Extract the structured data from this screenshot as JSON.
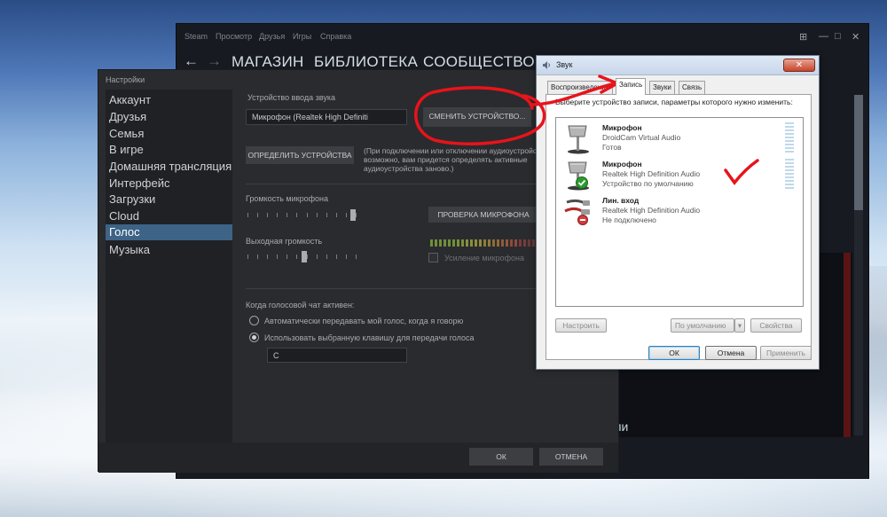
{
  "steam": {
    "menu": [
      "Steam",
      "Просмотр",
      "Друзья",
      "Игры",
      "Справка"
    ],
    "nav": {
      "back": "←",
      "forward": "→",
      "store": "МАГАЗИН",
      "library": "БИБЛИОТЕКА",
      "community": "СООБЩЕСТВО"
    },
    "window_controls": {
      "gamepad": "🎮",
      "minimize": "—",
      "maximize": "□",
      "close": "✕"
    },
    "game_text": "ели"
  },
  "settings": {
    "title": "Настройки",
    "sidebar": [
      {
        "label": "Аккаунт",
        "active": false
      },
      {
        "label": "Друзья",
        "active": false
      },
      {
        "label": "Семья",
        "active": false
      },
      {
        "label": "В игре",
        "active": false
      },
      {
        "label": "Домашняя трансляция",
        "active": false
      },
      {
        "label": "Интерфейс",
        "active": false
      },
      {
        "label": "Загрузки",
        "active": false
      },
      {
        "label": "Cloud",
        "active": false
      },
      {
        "label": "Голос",
        "active": true
      },
      {
        "label": "Музыка",
        "active": false
      }
    ],
    "voice": {
      "input_device_label": "Устройство ввода звука",
      "input_device_value": "Микрофон (Realtek High Definiti",
      "change_device_button": "СМЕНИТЬ УСТРОЙСТВО...",
      "detect_devices_button": "ОПРЕДЕЛИТЬ УСТРОЙСТВА",
      "detect_note_1": "(При подключении или отключении аудиоустройств",
      "detect_note_2": "возможно, вам придется определять активные",
      "detect_note_3": "аудиоустройства заново.)",
      "mic_volume_label": "Громкость микрофона",
      "mic_volume_level": 0.95,
      "test_mic_button": "ПРОВЕРКА МИКРОФОНА",
      "output_volume_label": "Выходная громкость",
      "output_volume_level": 0.5,
      "mic_boost_label": "Усиление микрофона",
      "voice_active_label": "Когда голосовой чат активен:",
      "radio_auto": "Автоматически передавать мой голос, когда я говорю",
      "radio_key": "Использовать выбранную клавишу для передачи голоса",
      "key_value": "C",
      "ok_button": "ОК",
      "cancel_button": "ОТМЕНА"
    }
  },
  "sound_dialog": {
    "title": "Звук",
    "close": "✕",
    "tabs": [
      {
        "label": "Воспроизведение",
        "active": false
      },
      {
        "label": "Запись",
        "active": true
      },
      {
        "label": "Звуки",
        "active": false
      },
      {
        "label": "Связь",
        "active": false
      }
    ],
    "instruction": "Выберите устройство записи, параметры которого нужно изменить:",
    "devices": [
      {
        "name": "Микрофон",
        "driver": "DroidCam Virtual Audio",
        "status": "Готов"
      },
      {
        "name": "Микрофон",
        "driver": "Realtek High Definition Audio",
        "status": "Устройство по умолчанию"
      },
      {
        "name": "Лин. вход",
        "driver": "Realtek High Definition Audio",
        "status": "Не подключено"
      }
    ],
    "configure_button": "Настроить",
    "default_button": "По умолчанию",
    "properties_button": "Свойства",
    "ok_button": "ОК",
    "cancel_button": "Отмена",
    "apply_button": "Применить"
  }
}
